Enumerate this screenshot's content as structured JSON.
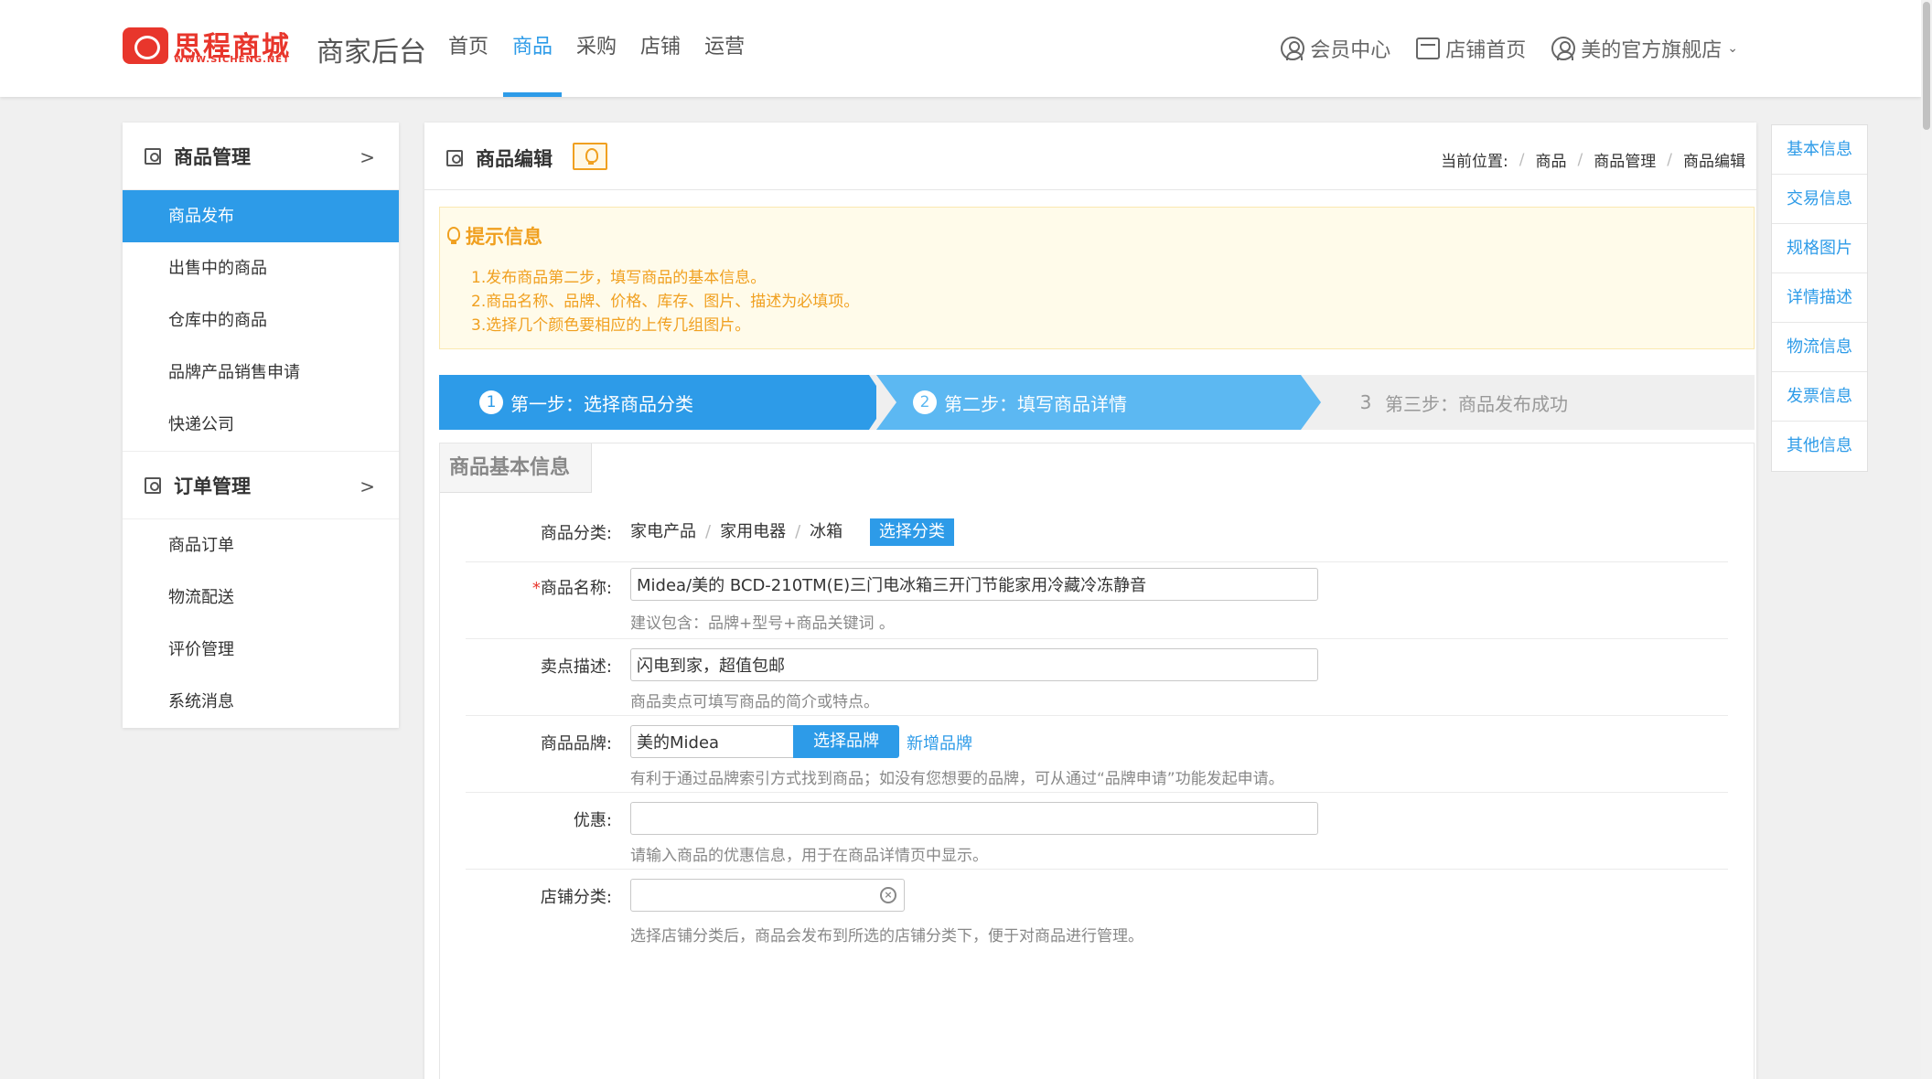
{
  "header": {
    "logo_text": "思程商城",
    "logo_sub": "WWW.SICHENG.NET",
    "app_title": "商家后台",
    "nav": [
      {
        "label": "首页",
        "active": false
      },
      {
        "label": "商品",
        "active": true
      },
      {
        "label": "采购",
        "active": false
      },
      {
        "label": "店铺",
        "active": false
      },
      {
        "label": "运营",
        "active": false
      }
    ],
    "member_center": "会员中心",
    "store_home": "店铺首页",
    "store_name": "美的官方旗舰店",
    "accent_color": "#2d9be8"
  },
  "sidebar": {
    "groups": [
      {
        "title": "商品管理",
        "items": [
          {
            "label": "商品发布",
            "active": true
          },
          {
            "label": "出售中的商品",
            "active": false
          },
          {
            "label": "仓库中的商品",
            "active": false
          },
          {
            "label": "品牌产品销售申请",
            "active": false
          },
          {
            "label": "快递公司",
            "active": false
          }
        ]
      },
      {
        "title": "订单管理",
        "items": [
          {
            "label": "商品订单",
            "active": false
          },
          {
            "label": "物流配送",
            "active": false
          },
          {
            "label": "评价管理",
            "active": false
          },
          {
            "label": "系统消息",
            "active": false
          }
        ]
      }
    ]
  },
  "main": {
    "title": "商品编辑",
    "breadcrumb": {
      "prefix": "当前位置:",
      "items": [
        "商品",
        "商品管理",
        "商品编辑"
      ]
    },
    "tips": {
      "title": "提示信息",
      "lines": [
        "1.发布商品第二步，填写商品的基本信息。",
        "2.商品名称、品牌、价格、库存、图片、描述为必填项。",
        "3.选择几个颜色要相应的上传几组图片。"
      ]
    },
    "steps": [
      {
        "num": "1",
        "label": "第一步：选择商品分类"
      },
      {
        "num": "2",
        "label": "第二步：填写商品详情"
      },
      {
        "num": "3",
        "label": "第三步：商品发布成功"
      }
    ],
    "section_tab": "商品基本信息",
    "form": {
      "category": {
        "label": "商品分类:",
        "path": [
          "家电产品",
          "家用电器",
          "冰箱"
        ],
        "button": "选择分类"
      },
      "name": {
        "required_mark": "*",
        "label": "商品名称:",
        "value": "Midea/美的 BCD-210TM(E)三门电冰箱三开门节能家用冷藏冷冻静音",
        "hint": "建议包含：品牌+型号+商品关键词 。"
      },
      "selling_point": {
        "label": "卖点描述:",
        "value": "闪电到家，超值包邮",
        "hint": "商品卖点可填写商品的简介或特点。"
      },
      "brand": {
        "label": "商品品牌:",
        "value": "美的Midea",
        "button": "选择品牌",
        "link": "新增品牌",
        "hint": "有利于通过品牌索引方式找到商品；如没有您想要的品牌，可从通过“品牌申请”功能发起申请。"
      },
      "discount": {
        "label": "优惠:",
        "value": "",
        "hint": "请输入商品的优惠信息，用于在商品详情页中显示。"
      },
      "store_category": {
        "label": "店铺分类:",
        "hint": "选择店铺分类后，商品会发布到所选的店铺分类下，便于对商品进行管理。"
      }
    }
  },
  "anchors": [
    "基本信息",
    "交易信息",
    "规格图片",
    "详情描述",
    "物流信息",
    "发票信息",
    "其他信息"
  ]
}
